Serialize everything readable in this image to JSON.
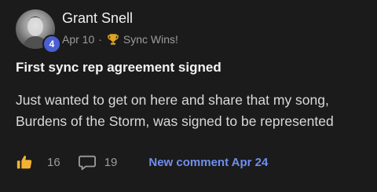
{
  "post": {
    "author": "Grant Snell",
    "level": "4",
    "date": "Apr 10",
    "separator": "·",
    "badge_label": "Sync Wins!",
    "title": "First sync rep agreement signed",
    "body": "Just wanted to get on here and share that my song, Burdens of the Storm, was signed to be represented",
    "likes": "16",
    "comments": "19",
    "new_comment": "New comment Apr 24"
  },
  "colors": {
    "background": "#1b1b1b",
    "level_badge": "#4a5fd1",
    "trophy": "#e0a326",
    "like_icon": "#f2b233",
    "link": "#6f8ff0"
  },
  "icons": {
    "trophy": "trophy-icon",
    "like": "thumbs-up-icon",
    "comment": "comment-bubble-icon"
  }
}
